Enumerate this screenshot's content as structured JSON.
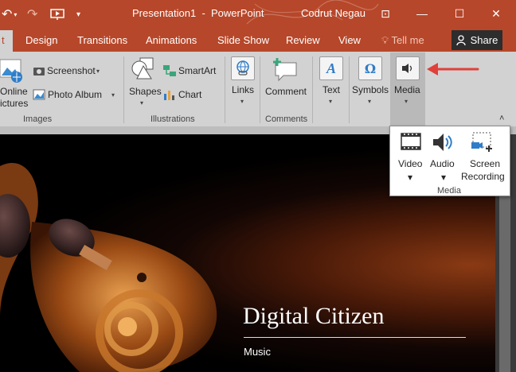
{
  "titlebar": {
    "title": "Presentation1  -  PowerPoint",
    "user": "Codrut Negau",
    "undo": "↶",
    "redo": "↷",
    "qat_more": "▾",
    "ribbon_display": "⊡",
    "minimize": "—",
    "maximize": "☐",
    "close": "✕"
  },
  "tabs": {
    "active_partial": "t",
    "items": [
      "Design",
      "Transitions",
      "Animations",
      "Slide Show",
      "Review",
      "View"
    ],
    "tell_me": "Tell me",
    "share": "Share"
  },
  "ribbon": {
    "images": {
      "online_line1": "Online",
      "online_line2": "ictures",
      "screenshot": "Screenshot",
      "photo_album": "Photo Album",
      "label": "Images"
    },
    "illustrations": {
      "shapes": "Shapes",
      "smartart": "SmartArt",
      "chart": "Chart",
      "label": "Illustrations"
    },
    "links": {
      "label_btn": "Links"
    },
    "comments": {
      "comment": "Comment",
      "label": "Comments"
    },
    "text": {
      "label_btn": "Text"
    },
    "symbols": {
      "label_btn": "Symbols"
    },
    "media": {
      "label_btn": "Media"
    }
  },
  "dropdown": {
    "video": "Video",
    "audio": "Audio",
    "screen_line1": "Screen",
    "screen_line2": "Recording",
    "label": "Media"
  },
  "slide": {
    "title": "Digital Citizen",
    "subtitle": "Music"
  },
  "colors": {
    "accent": "#b7472a",
    "arrow": "#e0403a"
  }
}
